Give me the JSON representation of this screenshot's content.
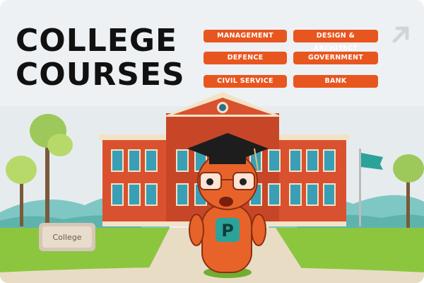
{
  "title": {
    "line1": "COLLEGE",
    "line2": "COURSES"
  },
  "courses": [
    {
      "label": "MANAGEMENT"
    },
    {
      "label": "DESIGN & ARCHITECT"
    },
    {
      "label": "DEFENCE"
    },
    {
      "label": "GOVERNMENT"
    },
    {
      "label": "CIVIL SERVICE"
    },
    {
      "label": "BANK"
    }
  ],
  "sign_text": "College",
  "mascot_letter": "P",
  "icons": {
    "arrow": "arrow-up-right-icon"
  },
  "colors": {
    "accent": "#e8561f",
    "background": "#eef1f3",
    "brick": "#d9512e",
    "grass": "#8cc63f",
    "mascot": "#e8632a",
    "flag": "#2ba39a"
  }
}
